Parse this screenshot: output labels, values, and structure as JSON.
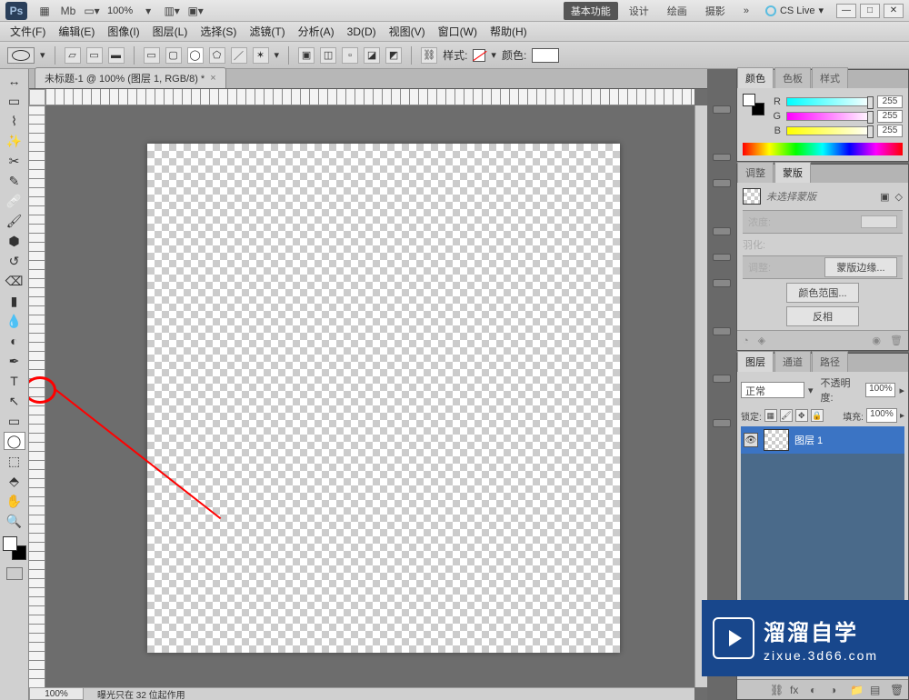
{
  "titlebar": {
    "zoom": "100%",
    "workspaces": [
      "基本功能",
      "设计",
      "绘画",
      "摄影"
    ],
    "more": "»",
    "cslive": "CS Live"
  },
  "menu": [
    "文件(F)",
    "编辑(E)",
    "图像(I)",
    "图层(L)",
    "选择(S)",
    "滤镜(T)",
    "分析(A)",
    "3D(D)",
    "视图(V)",
    "窗口(W)",
    "帮助(H)"
  ],
  "optionsbar": {
    "style_label": "样式:",
    "color_label": "颜色:"
  },
  "document": {
    "tab": "未标题-1 @ 100% (图层 1, RGB/8) *",
    "zoom": "100%",
    "status_msg": "曝光只在 32 位起作用"
  },
  "panels": {
    "color": {
      "tabs": [
        "颜色",
        "色板",
        "样式"
      ],
      "r": 255,
      "g": 255,
      "b": 255
    },
    "mask": {
      "tabs": [
        "调整",
        "蒙版"
      ],
      "empty_text": "未选择蒙版",
      "density_label": "浓度:",
      "feather_label": "羽化:",
      "adjust_label": "调整:",
      "btn_edge": "蒙版边缘...",
      "btn_range": "颜色范围...",
      "btn_invert": "反相"
    },
    "layers": {
      "tabs": [
        "图层",
        "通道",
        "路径"
      ],
      "mode": "正常",
      "opacity_label": "不透明度:",
      "opacity": "100%",
      "lock_label": "锁定:",
      "fill_label": "填充:",
      "fill": "100%",
      "layer_name": "图层 1"
    }
  },
  "watermark": {
    "title": "溜溜自学",
    "url": "zixue.3d66.com"
  }
}
